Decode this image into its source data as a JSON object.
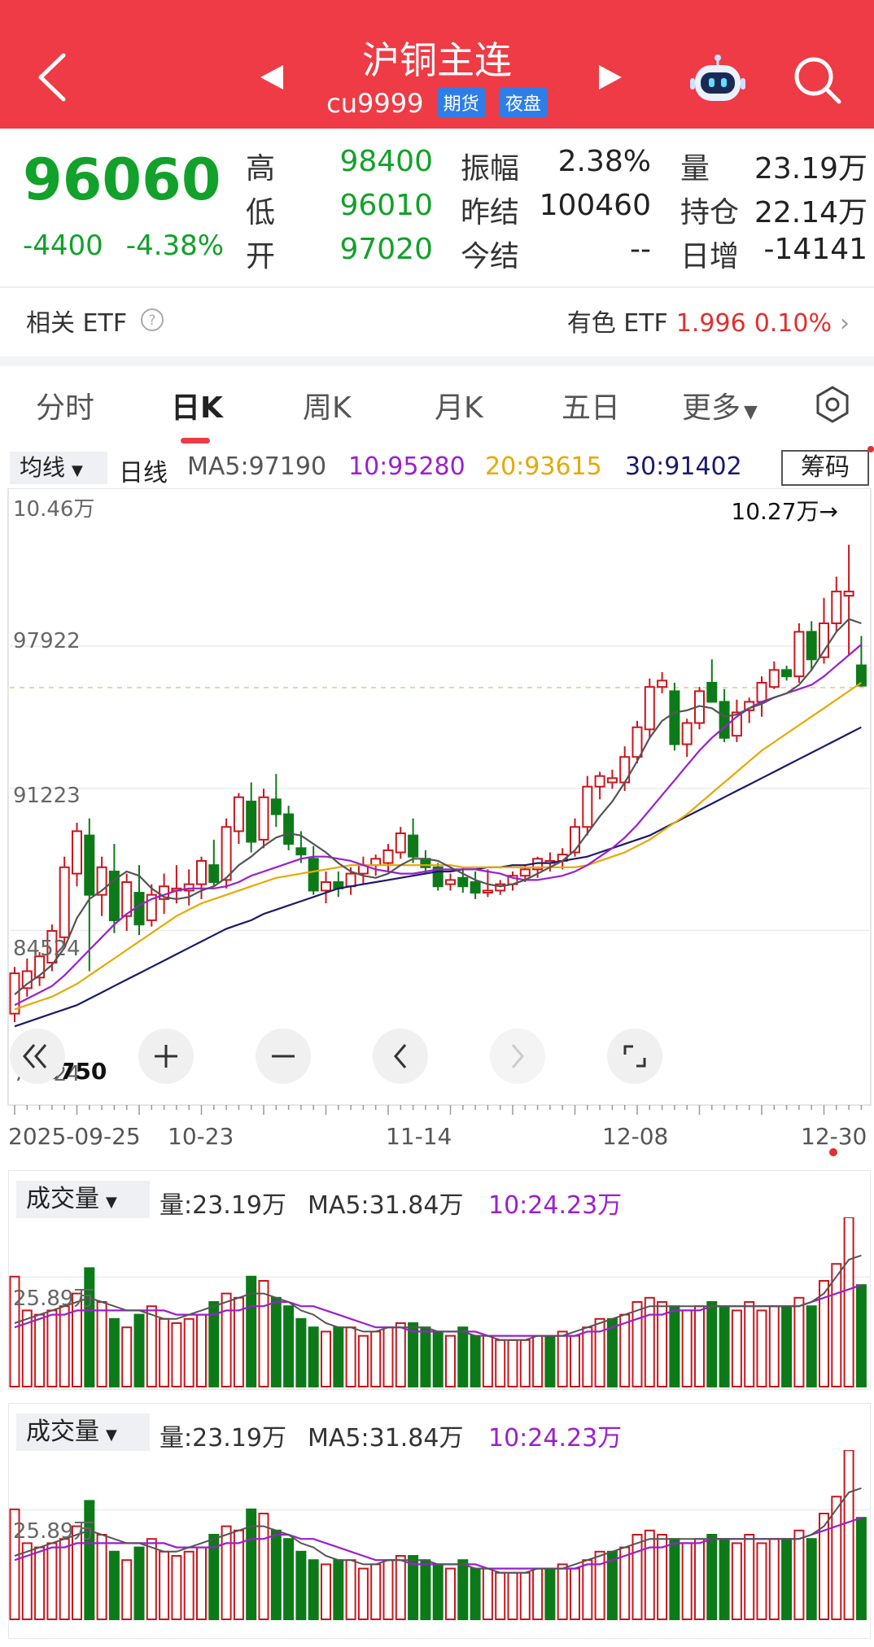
{
  "header": {
    "title": "沪铜主连",
    "code": "cu9999",
    "tags": [
      "期货",
      "夜盘"
    ],
    "bg_color": "#ee3b45"
  },
  "quote": {
    "price": "96060",
    "change": "-4400",
    "change_pct": "-4.38%",
    "stats": [
      {
        "label": "高",
        "value": "98400"
      },
      {
        "label": "低",
        "value": "96010"
      },
      {
        "label": "开",
        "value": "97020"
      },
      {
        "label": "振幅",
        "value": "2.38%"
      },
      {
        "label": "昨结",
        "value": "100460"
      },
      {
        "label": "今结",
        "value": "--"
      },
      {
        "label": "量",
        "value": "23.19万"
      },
      {
        "label": "持仓",
        "value": "22.14万"
      },
      {
        "label": "日增",
        "value": "-14141"
      }
    ]
  },
  "etf": {
    "label": "相关 ETF",
    "name": "有色 ETF",
    "price": "1.996",
    "pct": "0.10%"
  },
  "tabs": [
    "分时",
    "日K",
    "周K",
    "月K",
    "五日",
    "更多"
  ],
  "active_tab": "日K",
  "ma": {
    "selector": "均线",
    "period": "日线",
    "ma5": "MA5:97190",
    "ma10": "10:95280",
    "ma20": "20:93615",
    "ma30": "30:91402",
    "chip_button": "筹码",
    "colors": {
      "ma5": "#555555",
      "ma10": "#9b1fd0",
      "ma20": "#e8a800",
      "ma30": "#1a1a6e"
    }
  },
  "chart_data": [
    {
      "type": "candlestick",
      "y_ticks": [
        "10.46万",
        "97922",
        "91223",
        "84524",
        "77824"
      ],
      "ylim": [
        77824,
        104600
      ],
      "high_label": "10.27万→",
      "low_label": "80750",
      "x_ticks": [
        "2025-09-25",
        "10-23",
        "11-14",
        "12-08",
        "12-30"
      ],
      "last_close": 96060,
      "up_color": "#c9161d",
      "down_color": "#0d7a19",
      "ohlc": [
        [
          80600,
          82800,
          80200,
          82500
        ],
        [
          81800,
          83200,
          81400,
          82600
        ],
        [
          82300,
          83500,
          81900,
          83300
        ],
        [
          83000,
          84800,
          82600,
          84500
        ],
        [
          84200,
          88000,
          83800,
          87500
        ],
        [
          87200,
          89600,
          86600,
          89200
        ],
        [
          89000,
          89800,
          82600,
          86200
        ],
        [
          86200,
          88000,
          85200,
          87500
        ],
        [
          87300,
          88600,
          84400,
          85000
        ],
        [
          85200,
          87200,
          84500,
          86800
        ],
        [
          86300,
          87600,
          84300,
          84800
        ],
        [
          85000,
          86700,
          84700,
          86200
        ],
        [
          86000,
          87200,
          85300,
          86600
        ],
        [
          86400,
          87600,
          85800,
          86500
        ],
        [
          86400,
          87400,
          85700,
          86700
        ],
        [
          86700,
          88000,
          86000,
          87800
        ],
        [
          87600,
          88800,
          86600,
          86800
        ],
        [
          86900,
          89800,
          86500,
          89400
        ],
        [
          89200,
          91000,
          88600,
          90800
        ],
        [
          90600,
          91500,
          88200,
          88700
        ],
        [
          88800,
          91200,
          88400,
          90800
        ],
        [
          90700,
          91900,
          89400,
          90000
        ],
        [
          90000,
          90400,
          88300,
          88600
        ],
        [
          88400,
          89200,
          87700,
          88100
        ],
        [
          87900,
          88500,
          86200,
          86400
        ],
        [
          86400,
          87300,
          85800,
          86800
        ],
        [
          86800,
          87300,
          86100,
          86500
        ],
        [
          86600,
          87500,
          86200,
          87200
        ],
        [
          87200,
          88000,
          86700,
          87600
        ],
        [
          87600,
          88100,
          87100,
          87900
        ],
        [
          87700,
          88600,
          87300,
          88300
        ],
        [
          88200,
          89400,
          87900,
          89100
        ],
        [
          89000,
          89800,
          87700,
          88000
        ],
        [
          87900,
          88300,
          87200,
          87500
        ],
        [
          87500,
          87700,
          86400,
          86600
        ],
        [
          86700,
          87200,
          86400,
          86900
        ],
        [
          87000,
          87500,
          86300,
          86600
        ],
        [
          86800,
          87300,
          86000,
          86300
        ],
        [
          86300,
          87400,
          86100,
          86400
        ],
        [
          86400,
          86900,
          86200,
          86700
        ],
        [
          86700,
          87300,
          86400,
          87100
        ],
        [
          87100,
          87600,
          86800,
          87400
        ],
        [
          87400,
          88000,
          87000,
          87900
        ],
        [
          87700,
          88200,
          87300,
          87800
        ],
        [
          87800,
          88400,
          87400,
          88100
        ],
        [
          88200,
          89800,
          88000,
          89400
        ],
        [
          89400,
          91800,
          89000,
          91300
        ],
        [
          91300,
          92000,
          90700,
          91800
        ],
        [
          91500,
          92100,
          91200,
          91700
        ],
        [
          91500,
          93200,
          91100,
          92700
        ],
        [
          92700,
          94400,
          92400,
          94100
        ],
        [
          94000,
          96400,
          93600,
          96000
        ],
        [
          96000,
          96700,
          95700,
          96300
        ],
        [
          95800,
          96200,
          93000,
          93300
        ],
        [
          93300,
          94500,
          92700,
          94300
        ],
        [
          94300,
          96000,
          94000,
          95800
        ],
        [
          96200,
          97300,
          95300,
          95300
        ],
        [
          95300,
          95900,
          93400,
          93600
        ],
        [
          93700,
          95400,
          93400,
          94800
        ],
        [
          94900,
          95500,
          94300,
          95300
        ],
        [
          95300,
          96500,
          94600,
          96200
        ],
        [
          96000,
          97200,
          95900,
          96800
        ],
        [
          96800,
          97000,
          96300,
          96500
        ],
        [
          96500,
          99000,
          96200,
          98600
        ],
        [
          98600,
          99100,
          96800,
          97300
        ],
        [
          97400,
          100200,
          97100,
          99000
        ],
        [
          99000,
          101200,
          98600,
          100500
        ],
        [
          100300,
          102700,
          97500,
          100500
        ],
        [
          97020,
          98400,
          96010,
          96060
        ]
      ],
      "ma5": [
        81500,
        82000,
        82400,
        82900,
        83700,
        85100,
        86000,
        86400,
        86900,
        87300,
        87100,
        86500,
        86100,
        86000,
        86100,
        86400,
        86600,
        87000,
        87600,
        88000,
        88500,
        88900,
        89100,
        89000,
        88600,
        88200,
        87700,
        87300,
        87100,
        87000,
        87200,
        87600,
        87900,
        87900,
        87800,
        87500,
        87200,
        86900,
        86700,
        86600,
        86700,
        86900,
        87200,
        87500,
        87800,
        88300,
        89100,
        89900,
        90600,
        91500,
        92500,
        93600,
        94400,
        94800,
        94900,
        95100,
        95000,
        94600,
        94700,
        95000,
        95200,
        95500,
        95700,
        96100,
        96800,
        97700,
        98600,
        99200,
        99000
      ],
      "ma10": [
        81000,
        81300,
        81600,
        81900,
        82400,
        83000,
        83600,
        84200,
        84800,
        85300,
        85700,
        86000,
        86200,
        86400,
        86500,
        86500,
        86500,
        86600,
        86800,
        87100,
        87300,
        87500,
        87700,
        87900,
        88000,
        88000,
        87900,
        87800,
        87600,
        87400,
        87300,
        87200,
        87200,
        87300,
        87400,
        87400,
        87400,
        87400,
        87300,
        87200,
        87000,
        86900,
        86900,
        87000,
        87100,
        87300,
        87600,
        88000,
        88400,
        88900,
        89500,
        90200,
        90900,
        91600,
        92300,
        93000,
        93600,
        94100,
        94600,
        95000,
        95300,
        95500,
        95700,
        95900,
        96100,
        96500,
        97000,
        97500,
        98000
      ],
      "ma20": [
        80800,
        81000,
        81200,
        81400,
        81700,
        82000,
        82400,
        82800,
        83200,
        83600,
        84000,
        84400,
        84800,
        85200,
        85500,
        85800,
        86000,
        86200,
        86400,
        86600,
        86800,
        87000,
        87100,
        87200,
        87300,
        87400,
        87500,
        87600,
        87600,
        87600,
        87600,
        87600,
        87600,
        87600,
        87600,
        87600,
        87500,
        87500,
        87500,
        87500,
        87500,
        87500,
        87500,
        87500,
        87500,
        87500,
        87600,
        87800,
        88000,
        88200,
        88500,
        88800,
        89200,
        89600,
        90000,
        90500,
        91000,
        91500,
        92000,
        92500,
        93000,
        93400,
        93800,
        94200,
        94600,
        95000,
        95400,
        95800,
        96200
      ],
      "ma30": [
        80000,
        80200,
        80400,
        80600,
        80800,
        81000,
        81300,
        81600,
        81900,
        82200,
        82500,
        82800,
        83100,
        83400,
        83700,
        84000,
        84300,
        84600,
        84800,
        85000,
        85300,
        85500,
        85700,
        85900,
        86100,
        86300,
        86500,
        86600,
        86700,
        86800,
        86900,
        87000,
        87100,
        87200,
        87300,
        87300,
        87400,
        87400,
        87500,
        87500,
        87600,
        87600,
        87700,
        87700,
        87800,
        87900,
        88000,
        88200,
        88400,
        88600,
        88800,
        89000,
        89300,
        89600,
        89900,
        90200,
        90500,
        90800,
        91100,
        91400,
        91700,
        92000,
        92300,
        92600,
        92900,
        93200,
        93500,
        93800,
        94100
      ]
    },
    {
      "type": "bar",
      "title": "成交量",
      "summary": [
        "量:23.19万",
        "MA5:31.84万",
        "10:24.23万"
      ],
      "y_ticks": [
        "25.89万"
      ],
      "ylim": [
        0,
        40
      ],
      "values": [
        26,
        18,
        17,
        18,
        19,
        22,
        28,
        20,
        16,
        14,
        17,
        19,
        16,
        15,
        16,
        17,
        20,
        22,
        21,
        26,
        25,
        21,
        19,
        16,
        14,
        13,
        14,
        14,
        12,
        13,
        14,
        15,
        15,
        14,
        13,
        12,
        14,
        12,
        12,
        11,
        11,
        11,
        12,
        12,
        13,
        12,
        14,
        16,
        16,
        17,
        20,
        21,
        20,
        19,
        18,
        19,
        20,
        19,
        18,
        20,
        18,
        19,
        19,
        21,
        19,
        25,
        29,
        40,
        24
      ],
      "up": [
        1,
        1,
        1,
        1,
        1,
        1,
        0,
        1,
        0,
        1,
        0,
        1,
        1,
        1,
        1,
        1,
        0,
        1,
        1,
        0,
        1,
        0,
        0,
        0,
        0,
        1,
        0,
        1,
        1,
        1,
        1,
        1,
        0,
        0,
        0,
        1,
        0,
        0,
        1,
        1,
        1,
        1,
        1,
        0,
        1,
        1,
        1,
        1,
        0,
        1,
        1,
        1,
        1,
        0,
        1,
        1,
        0,
        0,
        1,
        1,
        1,
        1,
        0,
        1,
        0,
        1,
        1,
        1,
        0
      ],
      "ma5": [
        15,
        16,
        17,
        18,
        19,
        20,
        21,
        20,
        19,
        18,
        18,
        17,
        16,
        16,
        17,
        18,
        19,
        20,
        21,
        22,
        22,
        21,
        20,
        18,
        17,
        15,
        14,
        14,
        13,
        13,
        14,
        14,
        14,
        14,
        13,
        13,
        13,
        12,
        12,
        11,
        11,
        11,
        12,
        12,
        12,
        13,
        14,
        15,
        16,
        17,
        18,
        19,
        19,
        19,
        19,
        19,
        19,
        19,
        19,
        19,
        19,
        19,
        19,
        19,
        20,
        22,
        26,
        30,
        31
      ],
      "ma10": [
        14,
        15,
        16,
        17,
        17,
        18,
        18,
        18,
        18,
        18,
        18,
        18,
        18,
        17,
        17,
        17,
        17,
        18,
        18,
        19,
        19,
        20,
        20,
        19,
        19,
        18,
        17,
        16,
        15,
        14,
        14,
        14,
        13,
        13,
        13,
        13,
        13,
        13,
        12,
        12,
        12,
        12,
        12,
        12,
        12,
        12,
        13,
        13,
        14,
        15,
        16,
        17,
        17,
        18,
        18,
        18,
        19,
        19,
        19,
        19,
        19,
        19,
        19,
        19,
        20,
        21,
        22,
        23,
        24
      ]
    },
    {
      "type": "bar",
      "title": "成交量",
      "summary": [
        "量:23.19万",
        "MA5:31.84万",
        "10:24.23万"
      ],
      "y_ticks": [
        "25.89万"
      ],
      "ylim": [
        0,
        40
      ],
      "values": [
        26,
        18,
        17,
        18,
        19,
        22,
        28,
        20,
        16,
        14,
        17,
        19,
        16,
        15,
        16,
        17,
        20,
        22,
        21,
        26,
        25,
        21,
        19,
        16,
        14,
        13,
        14,
        14,
        12,
        13,
        14,
        15,
        15,
        14,
        13,
        12,
        14,
        12,
        12,
        11,
        11,
        11,
        12,
        12,
        13,
        12,
        14,
        16,
        16,
        17,
        20,
        21,
        20,
        19,
        18,
        19,
        20,
        19,
        18,
        20,
        18,
        19,
        19,
        21,
        19,
        25,
        29,
        40,
        24
      ],
      "up": [
        1,
        1,
        1,
        1,
        1,
        1,
        0,
        1,
        0,
        1,
        0,
        1,
        1,
        1,
        1,
        1,
        0,
        1,
        1,
        0,
        1,
        0,
        0,
        0,
        0,
        1,
        0,
        1,
        1,
        1,
        1,
        1,
        0,
        0,
        0,
        1,
        0,
        0,
        1,
        1,
        1,
        1,
        1,
        0,
        1,
        1,
        1,
        1,
        0,
        1,
        1,
        1,
        1,
        0,
        1,
        1,
        0,
        0,
        1,
        1,
        1,
        1,
        0,
        1,
        0,
        1,
        1,
        1,
        0
      ],
      "ma5": [
        15,
        16,
        17,
        18,
        19,
        20,
        21,
        20,
        19,
        18,
        18,
        17,
        16,
        16,
        17,
        18,
        19,
        20,
        21,
        22,
        22,
        21,
        20,
        18,
        17,
        15,
        14,
        14,
        13,
        13,
        14,
        14,
        14,
        14,
        13,
        13,
        13,
        12,
        12,
        11,
        11,
        11,
        12,
        12,
        12,
        13,
        14,
        15,
        16,
        17,
        18,
        19,
        19,
        19,
        19,
        19,
        19,
        19,
        19,
        19,
        19,
        19,
        19,
        19,
        20,
        22,
        26,
        30,
        31
      ],
      "ma10": [
        14,
        15,
        16,
        17,
        17,
        18,
        18,
        18,
        18,
        18,
        18,
        18,
        18,
        17,
        17,
        17,
        17,
        18,
        18,
        19,
        19,
        20,
        20,
        19,
        19,
        18,
        17,
        16,
        15,
        14,
        14,
        14,
        13,
        13,
        13,
        13,
        13,
        13,
        12,
        12,
        12,
        12,
        12,
        12,
        12,
        12,
        13,
        13,
        14,
        15,
        16,
        17,
        17,
        18,
        18,
        18,
        19,
        19,
        19,
        19,
        19,
        19,
        19,
        19,
        20,
        21,
        22,
        23,
        24
      ]
    }
  ]
}
